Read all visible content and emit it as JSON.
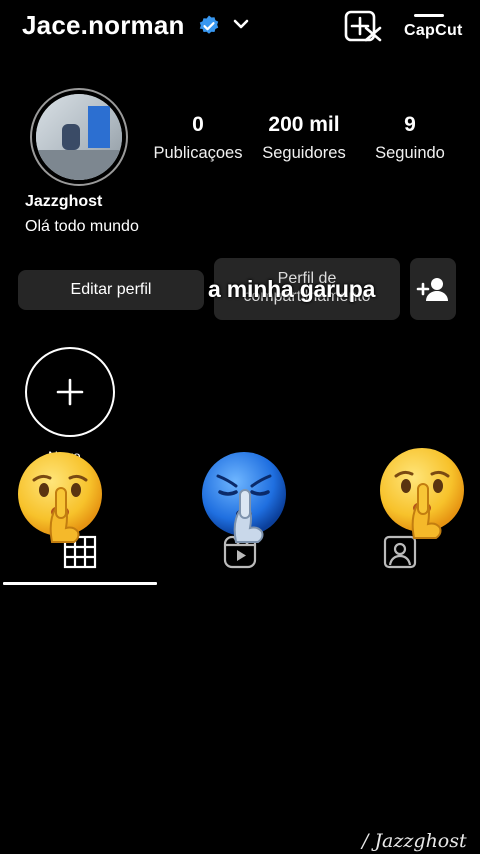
{
  "header": {
    "username": "Jace.norman",
    "capcut_text": "CapCut"
  },
  "profile": {
    "name": "Jazzghost",
    "bio": "Olá todo mundo"
  },
  "stats": [
    {
      "value": "0",
      "label": "Publicaçoes"
    },
    {
      "value": "200 mil",
      "label": "Seguidores"
    },
    {
      "value": "9",
      "label": "Seguindo"
    }
  ],
  "buttons": {
    "edit_label": "Editar perfil",
    "share_label": "Perfil de compartilhamento"
  },
  "caption": "a minha garupa",
  "highlight": {
    "new_label": "Novo"
  },
  "watermark": "/ Jazzghost",
  "colors": {
    "background": "#000000",
    "button_bg": "#262626",
    "verified_blue": "#3897f0"
  }
}
